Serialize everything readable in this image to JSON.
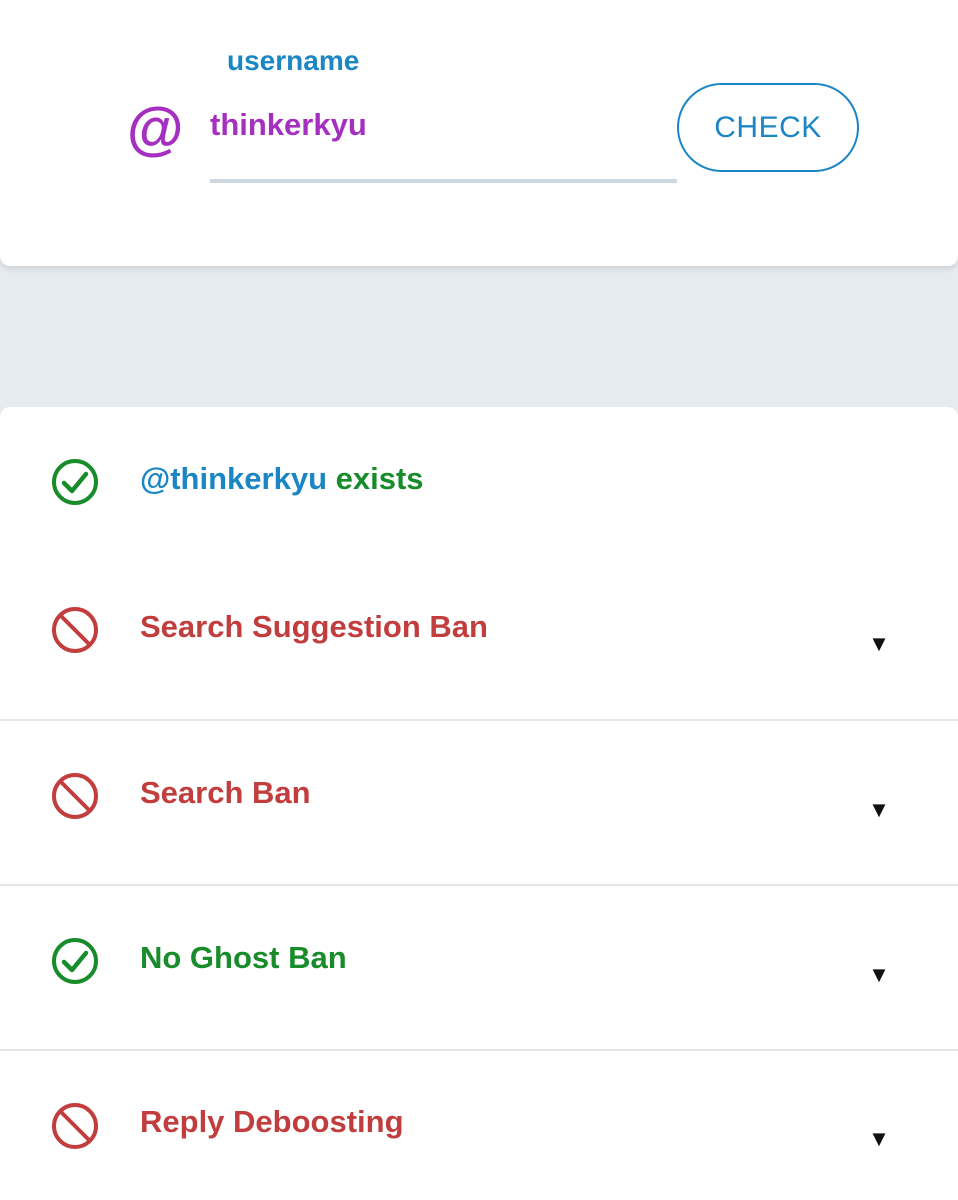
{
  "form": {
    "label": "username",
    "at_symbol": "@",
    "username_value": "thinkerkyu",
    "check_button": "CHECK"
  },
  "results": {
    "exists": {
      "handle": "@thinkerkyu",
      "suffix": " exists",
      "status": "ok",
      "icon": "check-circle-icon"
    },
    "items": [
      {
        "label": "Search Suggestion Ban",
        "status": "banned",
        "icon": "ban-icon",
        "toggle": "▼"
      },
      {
        "label": "Search Ban",
        "status": "banned",
        "icon": "ban-icon",
        "toggle": "▼"
      },
      {
        "label": "No Ghost Ban",
        "status": "ok",
        "icon": "check-circle-icon",
        "toggle": "▼"
      },
      {
        "label": "Reply Deboosting",
        "status": "banned",
        "icon": "ban-icon",
        "toggle": "▼"
      }
    ]
  },
  "colors": {
    "accent_blue": "#1b86c4",
    "username_purple": "#a42fc1",
    "ok_green": "#188c2b",
    "ban_red": "#c23d3d",
    "page_background": "#e6ebef"
  }
}
